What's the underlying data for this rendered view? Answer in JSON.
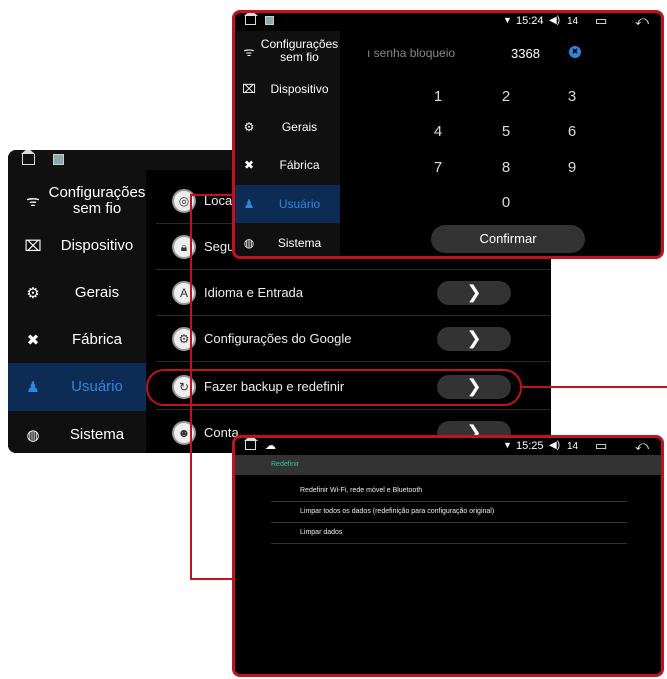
{
  "main": {
    "sidebar": [
      {
        "icon": "wifi-icon",
        "glyph": "ᯤ",
        "label": "Configurações sem fio"
      },
      {
        "icon": "device-icon",
        "glyph": "⌧",
        "label": "Dispositivo"
      },
      {
        "icon": "gear-icon",
        "glyph": "⚙",
        "label": "Gerais"
      },
      {
        "icon": "tools-icon",
        "glyph": "✖",
        "label": "Fábrica"
      },
      {
        "icon": "user-icon",
        "glyph": "♟",
        "label": "Usuário"
      },
      {
        "icon": "globe-icon",
        "glyph": "◍",
        "label": "Sistema"
      }
    ],
    "rows": [
      {
        "icon": "location-icon",
        "label": "Loca"
      },
      {
        "icon": "lock-icon",
        "label": "Segu"
      },
      {
        "icon": "language-icon",
        "label": "Idioma e Entrada"
      },
      {
        "icon": "google-settings-icon",
        "label": "Configurações do Google"
      },
      {
        "icon": "backup-icon",
        "label": "Fazer backup e redefinir"
      },
      {
        "icon": "account-icon",
        "label": "Conta"
      }
    ],
    "arrow": "❯"
  },
  "pop": {
    "status": {
      "time": "15:24",
      "volume": "14",
      "volume_glyph": "◀)",
      "wifi_glyph": "▼",
      "window_glyph": "▭",
      "back_glyph": "⤺"
    },
    "sidebar": [
      {
        "icon": "wifi-icon",
        "glyph": "ᯤ",
        "label": "Configurações sem fio"
      },
      {
        "icon": "device-icon",
        "glyph": "⌧",
        "label": "Dispositivo"
      },
      {
        "icon": "gear-icon",
        "glyph": "⚙",
        "label": "Gerais"
      },
      {
        "icon": "tools-icon",
        "glyph": "✖",
        "label": "Fábrica"
      },
      {
        "icon": "user-icon",
        "glyph": "♟",
        "label": "Usuário"
      },
      {
        "icon": "globe-icon",
        "glyph": "◍",
        "label": "Sistema"
      }
    ],
    "password_label": "ı senha bloqueio",
    "password_value": "3368",
    "clear_glyph": "✖",
    "keys": [
      "1",
      "2",
      "3",
      "4",
      "5",
      "6",
      "7",
      "8",
      "9",
      "0"
    ],
    "confirm": "Confirmar"
  },
  "pop2": {
    "status": {
      "time": "15:25",
      "volume": "14",
      "volume_glyph": "◀)",
      "wifi_glyph": "▼",
      "window_glyph": "▭",
      "back_glyph": "⤺",
      "cloud_glyph": "☁"
    },
    "header": "Redefinir",
    "options": [
      "Redefinir Wi-Fi, rede móvel e Bluetooth",
      "Limpar todos os dados (redefinição para configuração original)",
      "Limpar dados"
    ]
  },
  "colors": {
    "accent": "#2e86de",
    "highlight": "#c1121f",
    "teal": "#2ec4a0"
  }
}
